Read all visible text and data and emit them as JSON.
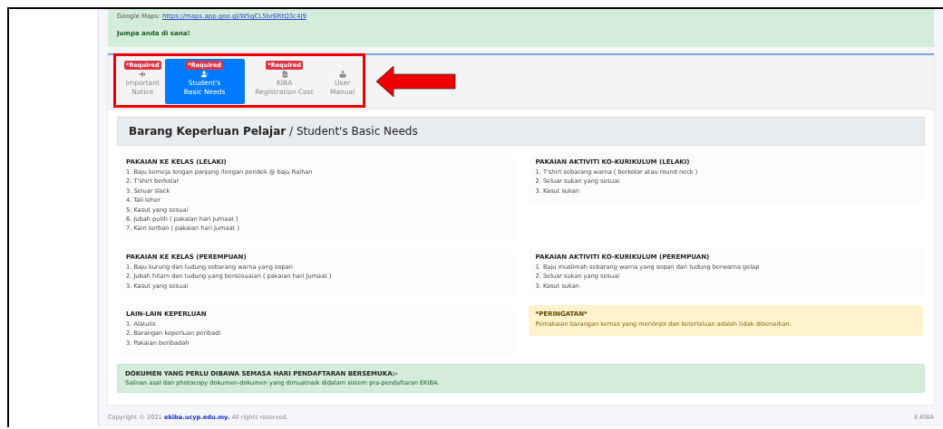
{
  "alert": {
    "maps_label": "Google Maps:",
    "maps_link": "https://maps.app.goo.gl/W5gCL5br6RtQ3c4J9",
    "greeting": "Jumpa anda di sana!"
  },
  "tabs": [
    {
      "badge": "*Required",
      "label": "Important Notice",
      "selected": false
    },
    {
      "badge": "*Required",
      "label": "Student's Basic Needs",
      "selected": true
    },
    {
      "badge": "*Required",
      "label": "KIBA Registration Cost",
      "selected": false
    },
    {
      "label": "User Manual",
      "selected": false
    }
  ],
  "section": {
    "title": "**Barang Keperluan Pelajar** / Student's Basic Needs"
  },
  "blocks": [
    {
      "kind": "list",
      "heading": "PAKAIAN KE KELAS (LELAKI)",
      "items": [
        "1. Baju kemeja lengan panjang /lengan pendek @ baju Raihan",
        "2. T'shirt berkolar",
        "3. Seluar slack",
        "4. Tali leher",
        "5. Kasut yang sesuai",
        "6. Jubah putih ( pakaian hari Jumaat )",
        "7. Kain serban ( pakaian hari Jumaat )"
      ]
    },
    {
      "kind": "list",
      "heading": "PAKAIAN AKTIVITI KO-KURIKULUM (LELAKI)",
      "items": [
        "1. T'shirt sebarang warna ( berkolar atau round neck )",
        "2. Seluar sukan yang sesuai",
        "3. Kasut sukan"
      ]
    },
    {
      "kind": "list",
      "heading": "PAKAIAN KE KELAS (PEREMPUAN)",
      "items": [
        "1. Baju kurung dan tudung sebarang warna yang sopan",
        "2. Jubah hitam dan tudung yang bersesuaian ( pakaian hari Jumaat )",
        "3. Kasut yang sesuai"
      ]
    },
    {
      "kind": "list",
      "heading": "PAKAIAN AKTIVITI KO-KURIKULUM (PEREMPUAN)",
      "items": [
        "1. Baju muslimah sebarang warna yang sopan dan tudung berwarna gelap",
        "2. Seluar sukan yang sesuai",
        "3. Kasut sukan"
      ]
    },
    {
      "kind": "list",
      "heading": "LAIN-LAIN KEPERLUAN",
      "items": [
        "1. Alatulis",
        "2. Barangan keperluan peribadi",
        "3. Pakaian beribadah"
      ]
    },
    {
      "kind": "warning",
      "heading": "*PERINGATAN*",
      "items": [
        "Pemakaian barangan kemas yang menonjol dan keterlaluan adalah tidak dibenarkan."
      ]
    }
  ],
  "notice": {
    "heading": "DOKUMEN YANG PERLU DIBAWA SEMASA HARI PENDAFTARAN BERSEMUKA:-",
    "text": "Salinan asal dan photocopy dokumen-dokumen yang dimuatnaik didalam sistem pra-pendaftaran EKIBA."
  },
  "footer": {
    "copyright": "Copyright © 2021",
    "site": "ekiba.ucyp.edu.my.",
    "rest": "All rights reserved.",
    "brand": "E-KIBA"
  }
}
